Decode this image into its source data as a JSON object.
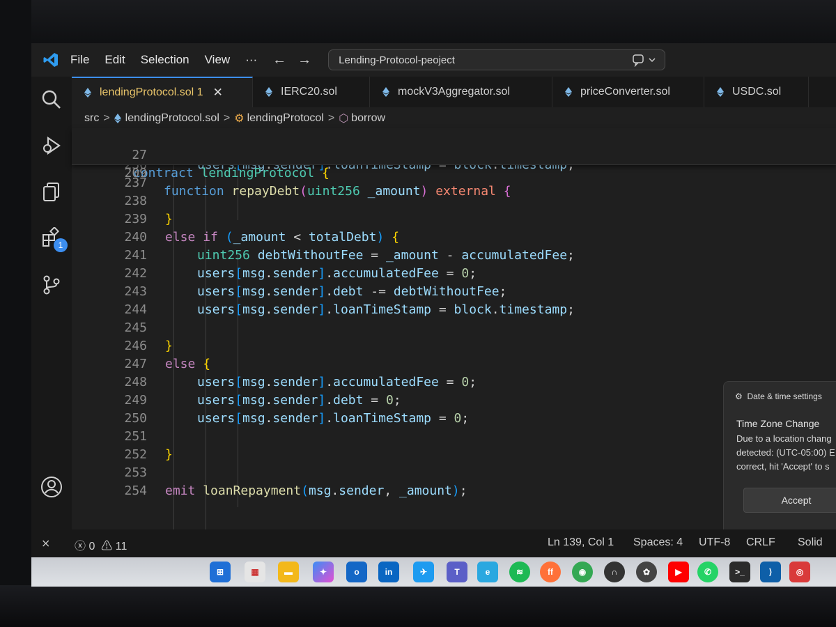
{
  "window": {
    "menu": [
      "File",
      "Edit",
      "Selection",
      "View",
      "···"
    ],
    "search_text": "Lending-Protocol-peoject"
  },
  "activity_bar": {
    "extensions_badge": "1"
  },
  "tabs": [
    {
      "label": "lendingProtocol.sol",
      "suffix": "1",
      "active": true
    },
    {
      "label": "IERC20.sol"
    },
    {
      "label": "mockV3Aggregator.sol"
    },
    {
      "label": "priceConverter.sol"
    },
    {
      "label": "USDC.sol"
    }
  ],
  "breadcrumb": [
    "src",
    "lendingProtocol.sol",
    "lendingProtocol",
    "borrow"
  ],
  "editor": {
    "sticky": [
      {
        "ln": "27",
        "text": "contract lendingProtocol {"
      },
      {
        "ln": "209",
        "text": "function repayDebt(uint256 _amount) external {"
      }
    ],
    "lines": [
      {
        "ln": "236",
        "text": "users[msg.sender].loanTimeStamp = block.timestamp;"
      },
      {
        "ln": "237",
        "text": ""
      },
      {
        "ln": "238",
        "text": ""
      },
      {
        "ln": "239",
        "text": "}"
      },
      {
        "ln": "240",
        "text": "else if (_amount < totalDebt) {"
      },
      {
        "ln": "241",
        "text": "uint256 debtWithoutFee = _amount - accumulatedFee;"
      },
      {
        "ln": "242",
        "text": "users[msg.sender].accumulatedFee = 0;"
      },
      {
        "ln": "243",
        "text": "users[msg.sender].debt -= debtWithoutFee;"
      },
      {
        "ln": "244",
        "text": "users[msg.sender].loanTimeStamp = block.timestamp;"
      },
      {
        "ln": "245",
        "text": ""
      },
      {
        "ln": "246",
        "text": "}"
      },
      {
        "ln": "247",
        "text": "else {"
      },
      {
        "ln": "248",
        "text": "users[msg.sender].accumulatedFee = 0;"
      },
      {
        "ln": "249",
        "text": "users[msg.sender].debt = 0;"
      },
      {
        "ln": "250",
        "text": "users[msg.sender].loanTimeStamp = 0;"
      },
      {
        "ln": "251",
        "text": ""
      },
      {
        "ln": "252",
        "text": "}"
      },
      {
        "ln": "253",
        "text": ""
      },
      {
        "ln": "254",
        "text": "emit loanRepayment(msg.sender, _amount);"
      }
    ]
  },
  "notification": {
    "source": "Date & time settings",
    "title": "Time Zone Change",
    "body": "Due to a location chang detected: (UTC-05:00) E correct, hit 'Accept' to s",
    "button": "Accept"
  },
  "status_bar": {
    "errors": "0",
    "warnings": "11",
    "position": "Ln 139, Col 1",
    "spaces": "Spaces: 4",
    "encoding": "UTF-8",
    "eol": "CRLF",
    "extra": "Solid"
  },
  "colors": {
    "accent": "#3c8ef0",
    "editor_bg": "#1f1f1f",
    "active_tab_text": "#e8c46a"
  }
}
